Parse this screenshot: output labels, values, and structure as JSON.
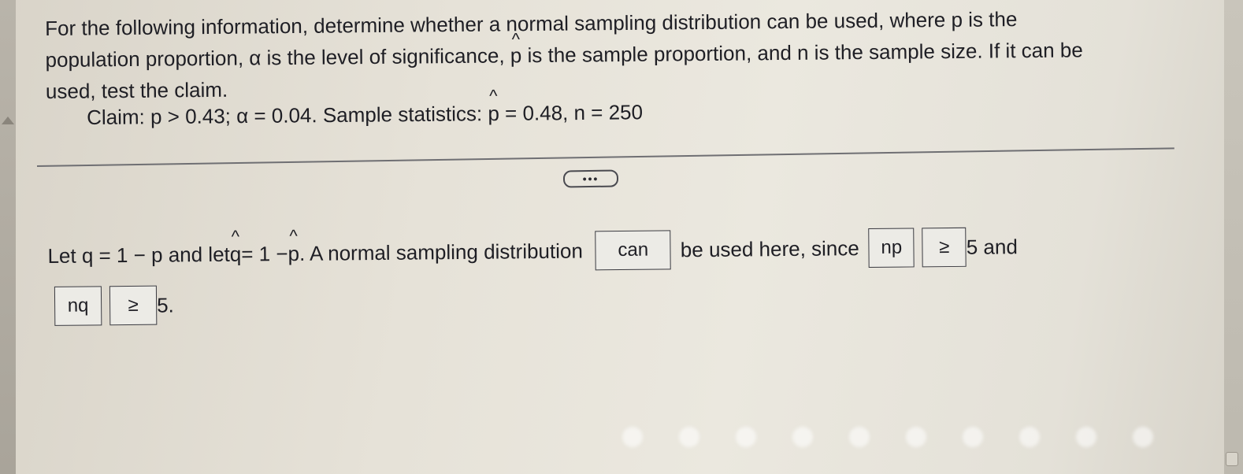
{
  "question": {
    "intro_a": "For the following information, determine whether a normal sampling distribution can be used, where p is the population proportion, α is the level of significance, ",
    "phat": "p",
    "intro_b": " is the sample proportion, and n is the sample size. If  it can be used, test the claim.",
    "claim_a": "Claim: p > 0.43; α = 0.04. Sample statistics: ",
    "claim_phat": "p",
    "claim_b": " = 0.48, n = 250"
  },
  "expand_button": "•••",
  "answer": {
    "text_a": "Let q = 1 − p and let ",
    "qhat": "q",
    "text_b": " = 1 − ",
    "phat": "p",
    "text_c": ". A normal sampling distribution",
    "box_can": "can",
    "text_d": "be used here, since",
    "box_np": "np",
    "box_ge1": "≥",
    "text_e": "5 and",
    "box_nq": "nq",
    "box_ge2": "≥",
    "text_f": "5."
  }
}
